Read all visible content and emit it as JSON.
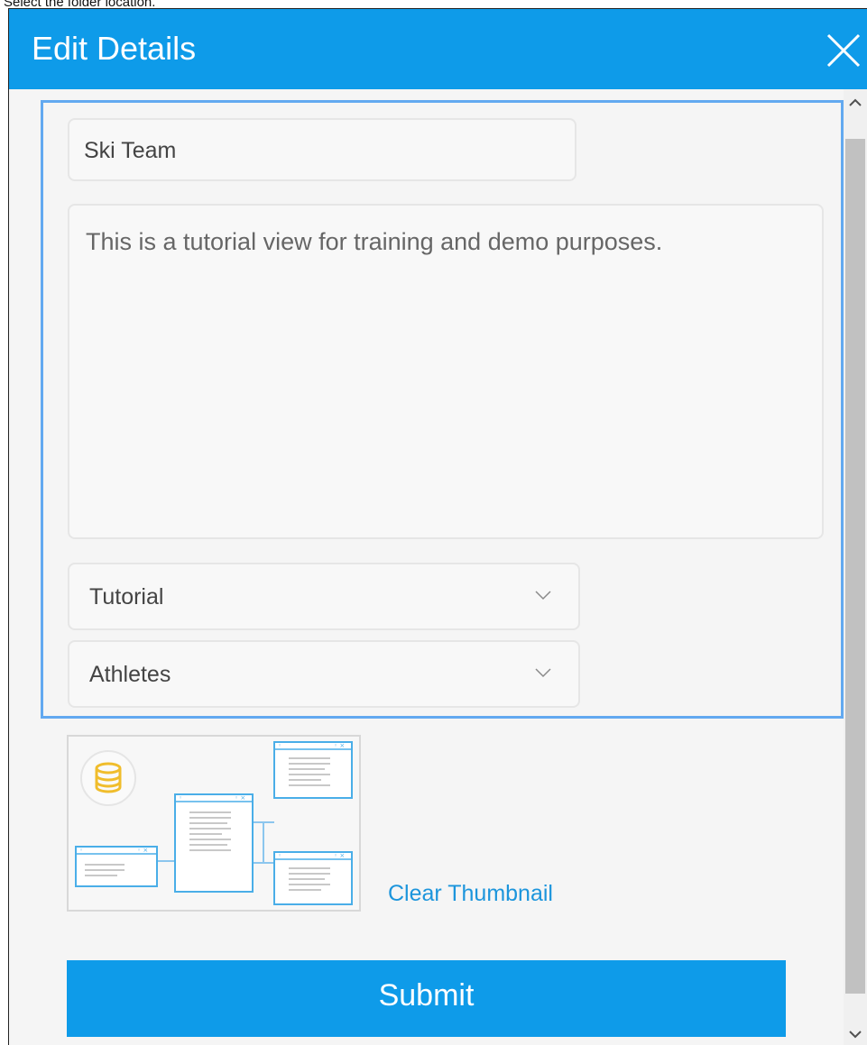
{
  "caption": "Select the folder location.",
  "dialog": {
    "title": "Edit Details",
    "close_icon": "close-icon"
  },
  "form": {
    "name_value": "Ski Team",
    "description_value": "This is a tutorial view for training and demo purposes.",
    "folder_value": "Tutorial",
    "subfolder_value": "Athletes"
  },
  "thumbnail": {
    "clear_label": "Clear Thumbnail"
  },
  "submit_label": "Submit",
  "colors": {
    "accent": "#0e9be9",
    "focus_border": "#62a9f0",
    "link": "#1c95dc"
  }
}
